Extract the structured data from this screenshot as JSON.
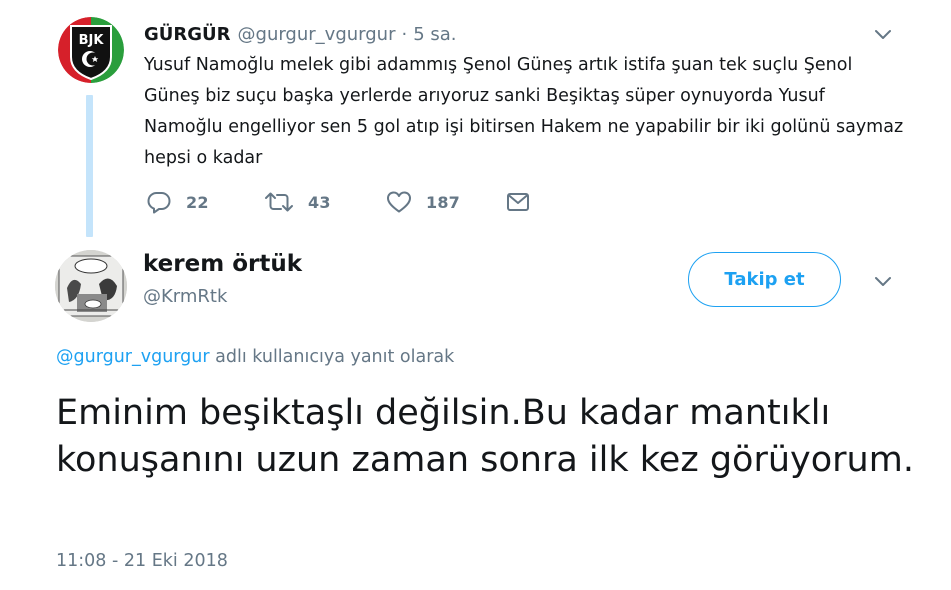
{
  "parent_tweet": {
    "display_name": "GÜRGÜR",
    "handle": "@gurgur_vgurgur",
    "separator": "·",
    "time_ago": "5 sa.",
    "avatar_text": "BJK",
    "text": "Yusuf Namoğlu melek gibi adammış Şenol Güneş artık istifa şuan tek suçlu Şenol Güneş biz suçu başka yerlerde arıyoruz sanki Beşiktaş süper oynuyorda Yusuf Namoğlu engelliyor sen 5 gol atıp  işi bitirsen Hakem ne yapabilir bir iki golünü saymaz hepsi o kadar",
    "reply_count": "22",
    "retweet_count": "43",
    "like_count": "187",
    "icons": [
      "reply-icon",
      "retweet-icon",
      "like-icon",
      "direct-message-icon",
      "chevron-down-icon"
    ]
  },
  "focused_tweet": {
    "display_name": "kerem örtük",
    "handle": "@KrmRtk",
    "follow_label": "Takip et",
    "reply_to_mention": "@gurgur_vgurgur",
    "reply_to_suffix": " adlı kullanıcıya yanıt olarak",
    "text": "Eminim beşiktaşlı değilsin.Bu kadar mantıklı konuşanını uzun zaman sonra ilk kez görüyorum.",
    "timestamp": "11:08 - 21 Eki 2018"
  },
  "colors": {
    "accent": "#1da1f2",
    "text": "#14171a",
    "secondary_text": "#657786",
    "thread_line": "#c4e4fb"
  }
}
